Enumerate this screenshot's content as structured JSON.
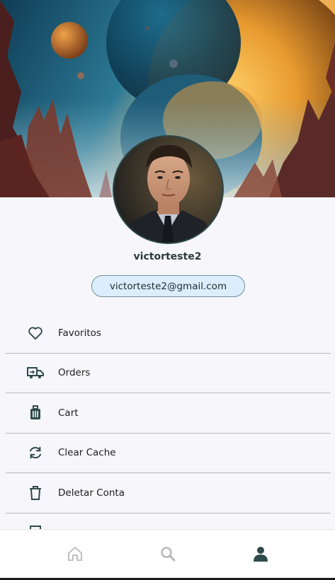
{
  "profile": {
    "username": "victorteste2",
    "email": "victorteste2@gmail.com"
  },
  "menu": {
    "items": [
      {
        "label": "Favoritos",
        "icon": "heart-icon"
      },
      {
        "label": "Orders",
        "icon": "truck-icon"
      },
      {
        "label": "Cart",
        "icon": "luggage-icon"
      },
      {
        "label": "Clear Cache",
        "icon": "refresh-icon"
      },
      {
        "label": "Deletar Conta",
        "icon": "trash-icon"
      }
    ]
  },
  "bottom_nav": {
    "items": [
      {
        "icon": "home-icon",
        "active": false
      },
      {
        "icon": "search-icon",
        "active": false
      },
      {
        "icon": "person-icon",
        "active": true
      }
    ]
  },
  "colors": {
    "accent": "#2f4a4a",
    "inactive": "#b7b7b7",
    "email_chip_bg": "#dceefb",
    "page_bg": "#f7f6fa"
  }
}
